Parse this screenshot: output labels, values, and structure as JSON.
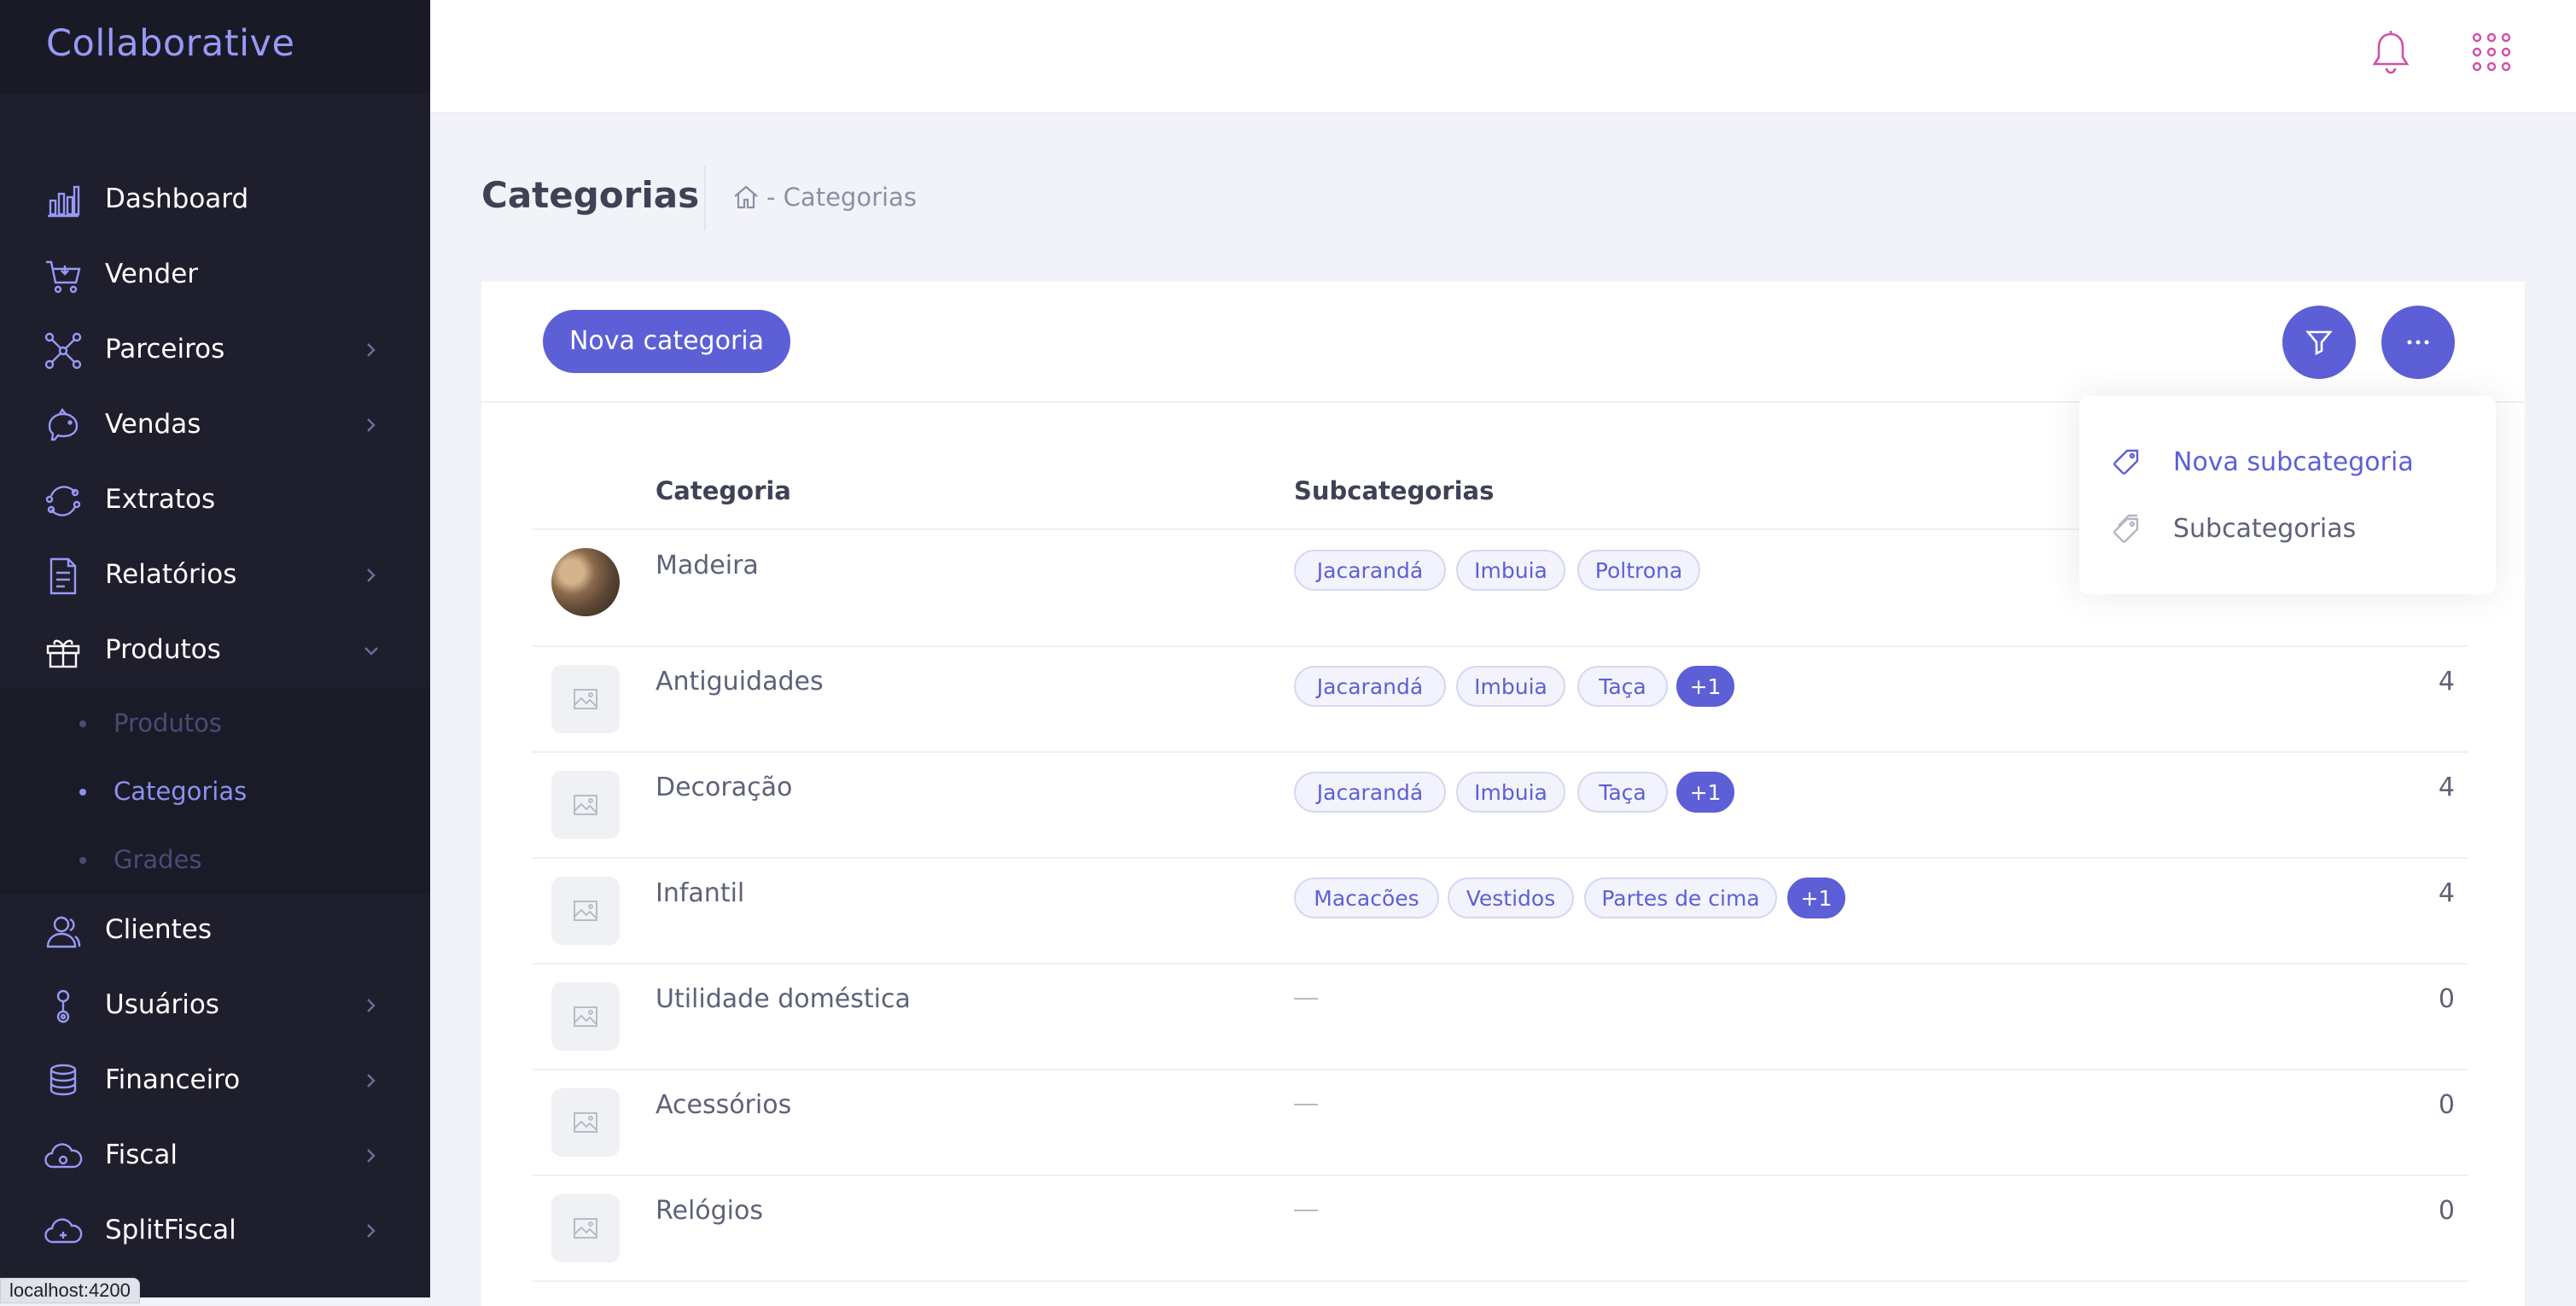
{
  "sidebar": {
    "brand": "Collaborative",
    "items": [
      {
        "label": "Dashboard",
        "icon": "chart-bars-icon"
      },
      {
        "label": "Vender",
        "icon": "cart-icon"
      },
      {
        "label": "Parceiros",
        "icon": "network-icon"
      },
      {
        "label": "Vendas",
        "icon": "piggy-bank-icon"
      },
      {
        "label": "Extratos",
        "icon": "refresh-cycle-icon"
      },
      {
        "label": "Relatórios",
        "icon": "report-icon"
      },
      {
        "label": "Produtos",
        "icon": "gift-box-icon"
      },
      {
        "label": "Clientes",
        "icon": "users-icon"
      },
      {
        "label": "Usuários",
        "icon": "user-pin-icon"
      },
      {
        "label": "Financeiro",
        "icon": "coins-icon"
      },
      {
        "label": "Fiscal",
        "icon": "cloud-icon"
      },
      {
        "label": "SplitFiscal",
        "icon": "cloud-split-icon"
      }
    ],
    "submenu": [
      {
        "label": "Produtos"
      },
      {
        "label": "Categorias"
      },
      {
        "label": "Grades"
      }
    ]
  },
  "status_url": "localhost:4200",
  "page": {
    "title": "Categorias",
    "breadcrumb": "- Categorias"
  },
  "toolbar": {
    "new_category": "Nova categoria"
  },
  "dropdown": {
    "items": [
      {
        "label": "Nova subcategoria"
      },
      {
        "label": "Subcategorias"
      }
    ]
  },
  "table": {
    "headers": {
      "category": "Categoria",
      "subcategories": "Subcategorias"
    },
    "empty_dash": "—",
    "rows": [
      {
        "name": "Madeira",
        "tags": [
          "Jacarandá",
          "Imbuia",
          "Poltrona"
        ],
        "more": "",
        "count": ""
      },
      {
        "name": "Antiguidades",
        "tags": [
          "Jacarandá",
          "Imbuia",
          "Taça"
        ],
        "more": "+1",
        "count": "4"
      },
      {
        "name": "Decoração",
        "tags": [
          "Jacarandá",
          "Imbuia",
          "Taça"
        ],
        "more": "+1",
        "count": "4"
      },
      {
        "name": "Infantil",
        "tags": [
          "Macacões",
          "Vestidos",
          "Partes de cima"
        ],
        "more": "+1",
        "count": "4"
      },
      {
        "name": "Utilidade doméstica",
        "tags": [],
        "more": "",
        "count": "0"
      },
      {
        "name": "Acessórios",
        "tags": [],
        "more": "",
        "count": "0"
      },
      {
        "name": "Relógios",
        "tags": [],
        "more": "",
        "count": "0"
      }
    ]
  },
  "colors": {
    "primary": "#5d5fd6",
    "sidebar_bg": "#1e1e2d",
    "accent_text": "#9899f5"
  }
}
